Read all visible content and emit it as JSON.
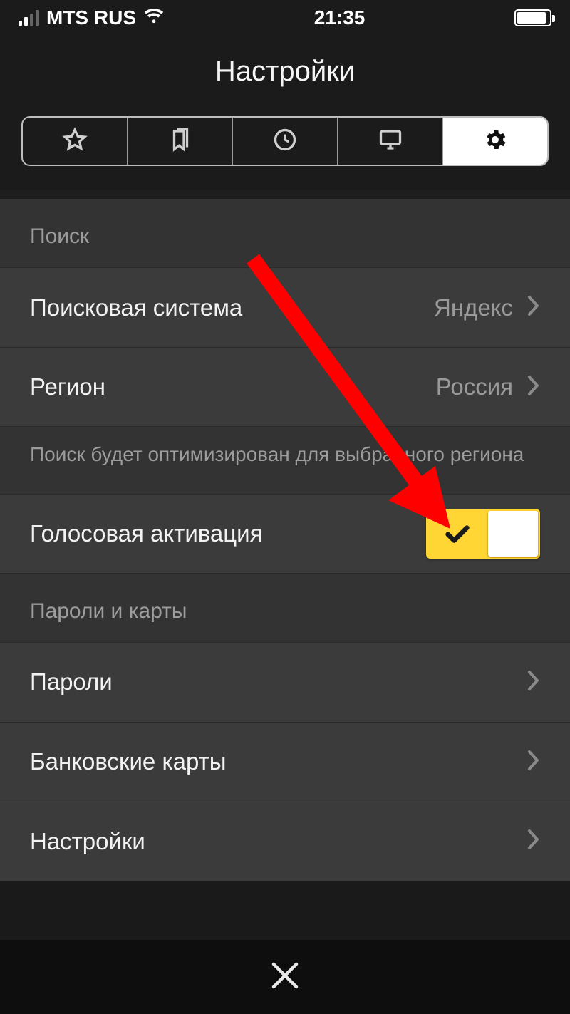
{
  "status_bar": {
    "carrier": "MTS RUS",
    "time": "21:35"
  },
  "header": {
    "title": "Настройки"
  },
  "tabs": {
    "items": [
      {
        "name": "favorites",
        "icon": "star-icon"
      },
      {
        "name": "bookmarks",
        "icon": "bookmarks-icon"
      },
      {
        "name": "history",
        "icon": "history-icon"
      },
      {
        "name": "tabs",
        "icon": "monitor-icon"
      },
      {
        "name": "settings",
        "icon": "gear-icon",
        "active": true
      }
    ]
  },
  "sections": {
    "search": {
      "header": "Поиск",
      "search_engine": {
        "label": "Поисковая система",
        "value": "Яндекс"
      },
      "region": {
        "label": "Регион",
        "value": "Россия"
      },
      "region_footer": "Поиск будет оптимизирован для выбранного региона",
      "voice_activation": {
        "label": "Голосовая активация",
        "value": true
      }
    },
    "passwords": {
      "header": "Пароли и карты",
      "passwords": {
        "label": "Пароли"
      },
      "cards": {
        "label": "Банковские карты"
      },
      "settings": {
        "label": "Настройки"
      }
    }
  },
  "annotation": {
    "arrow_color": "#ff0000"
  }
}
